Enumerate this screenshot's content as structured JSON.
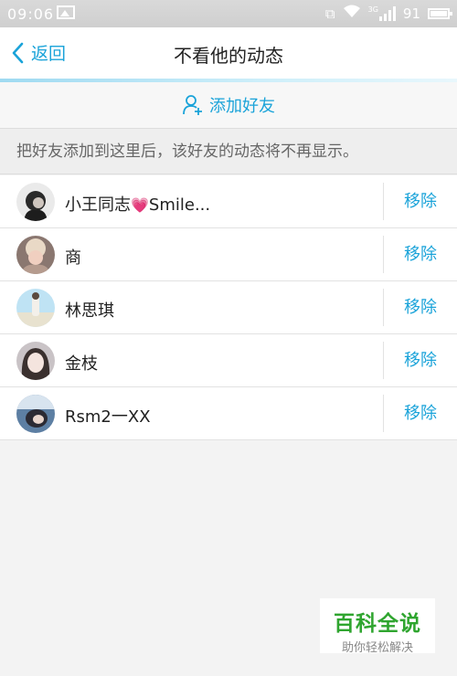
{
  "status_bar": {
    "time": "09:06",
    "network": "3G",
    "battery": "91"
  },
  "header": {
    "back_label": "返回",
    "title": "不看他的动态"
  },
  "add_friend": {
    "label": "添加好友"
  },
  "tip": "把好友添加到这里后，该好友的动态将不再显示。",
  "friends": [
    {
      "name": "小王同志",
      "suffix": "Smile...",
      "remove_label": "移除"
    },
    {
      "name": "商",
      "remove_label": "移除"
    },
    {
      "name": "林思琪",
      "remove_label": "移除"
    },
    {
      "name": "金枝",
      "remove_label": "移除"
    },
    {
      "name": "Rsm2一XX",
      "remove_label": "移除"
    }
  ],
  "watermark": {
    "title": "百科全说",
    "subtitle": "助你轻松解决"
  },
  "colors": {
    "accent": "#1aa3d9",
    "brand_green": "#2fa52f"
  }
}
